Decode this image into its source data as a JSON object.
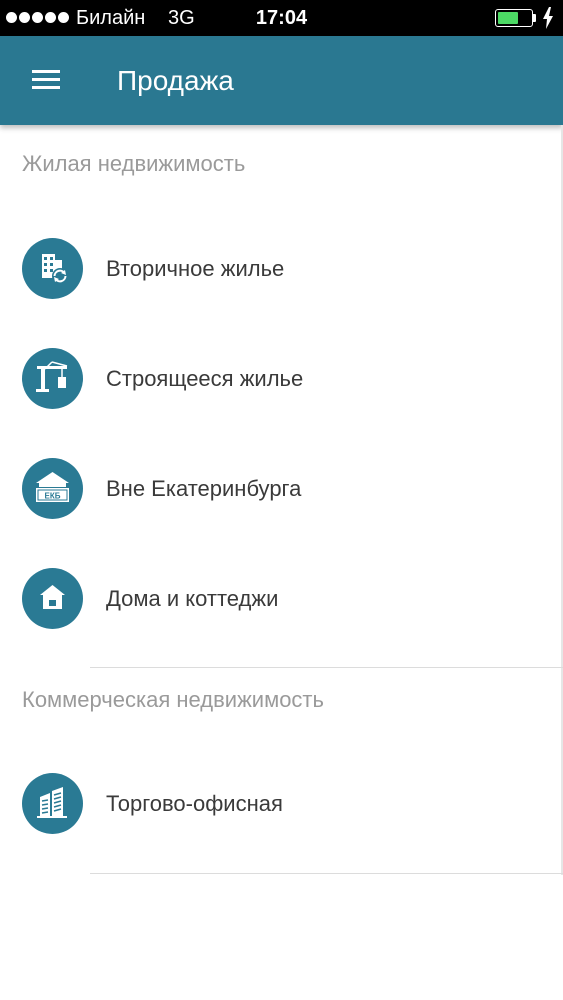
{
  "status_bar": {
    "carrier": "Билайн",
    "network": "3G",
    "time": "17:04",
    "battery_level": 0.65,
    "battery_color": "#4cd964"
  },
  "app_bar": {
    "title": "Продажа",
    "color": "#2a7891",
    "menu_icon": "hamburger-menu-icon"
  },
  "sections": [
    {
      "header": "Жилая недвижимость",
      "items": [
        {
          "label": "Вторичное жилье",
          "icon": "building-refresh-icon"
        },
        {
          "label": "Строящееся жилье",
          "icon": "construction-crane-icon"
        },
        {
          "label": "Вне Екатеринбурга",
          "icon": "ekb-sign-house-icon",
          "icon_text": "ЕКБ"
        },
        {
          "label": "Дома и коттеджи",
          "icon": "house-icon"
        }
      ]
    },
    {
      "header": "Коммерческая недвижимость",
      "items": [
        {
          "label": "Торгово-офисная",
          "icon": "office-buildings-icon"
        }
      ]
    }
  ],
  "accent_color": "#2a7a94"
}
